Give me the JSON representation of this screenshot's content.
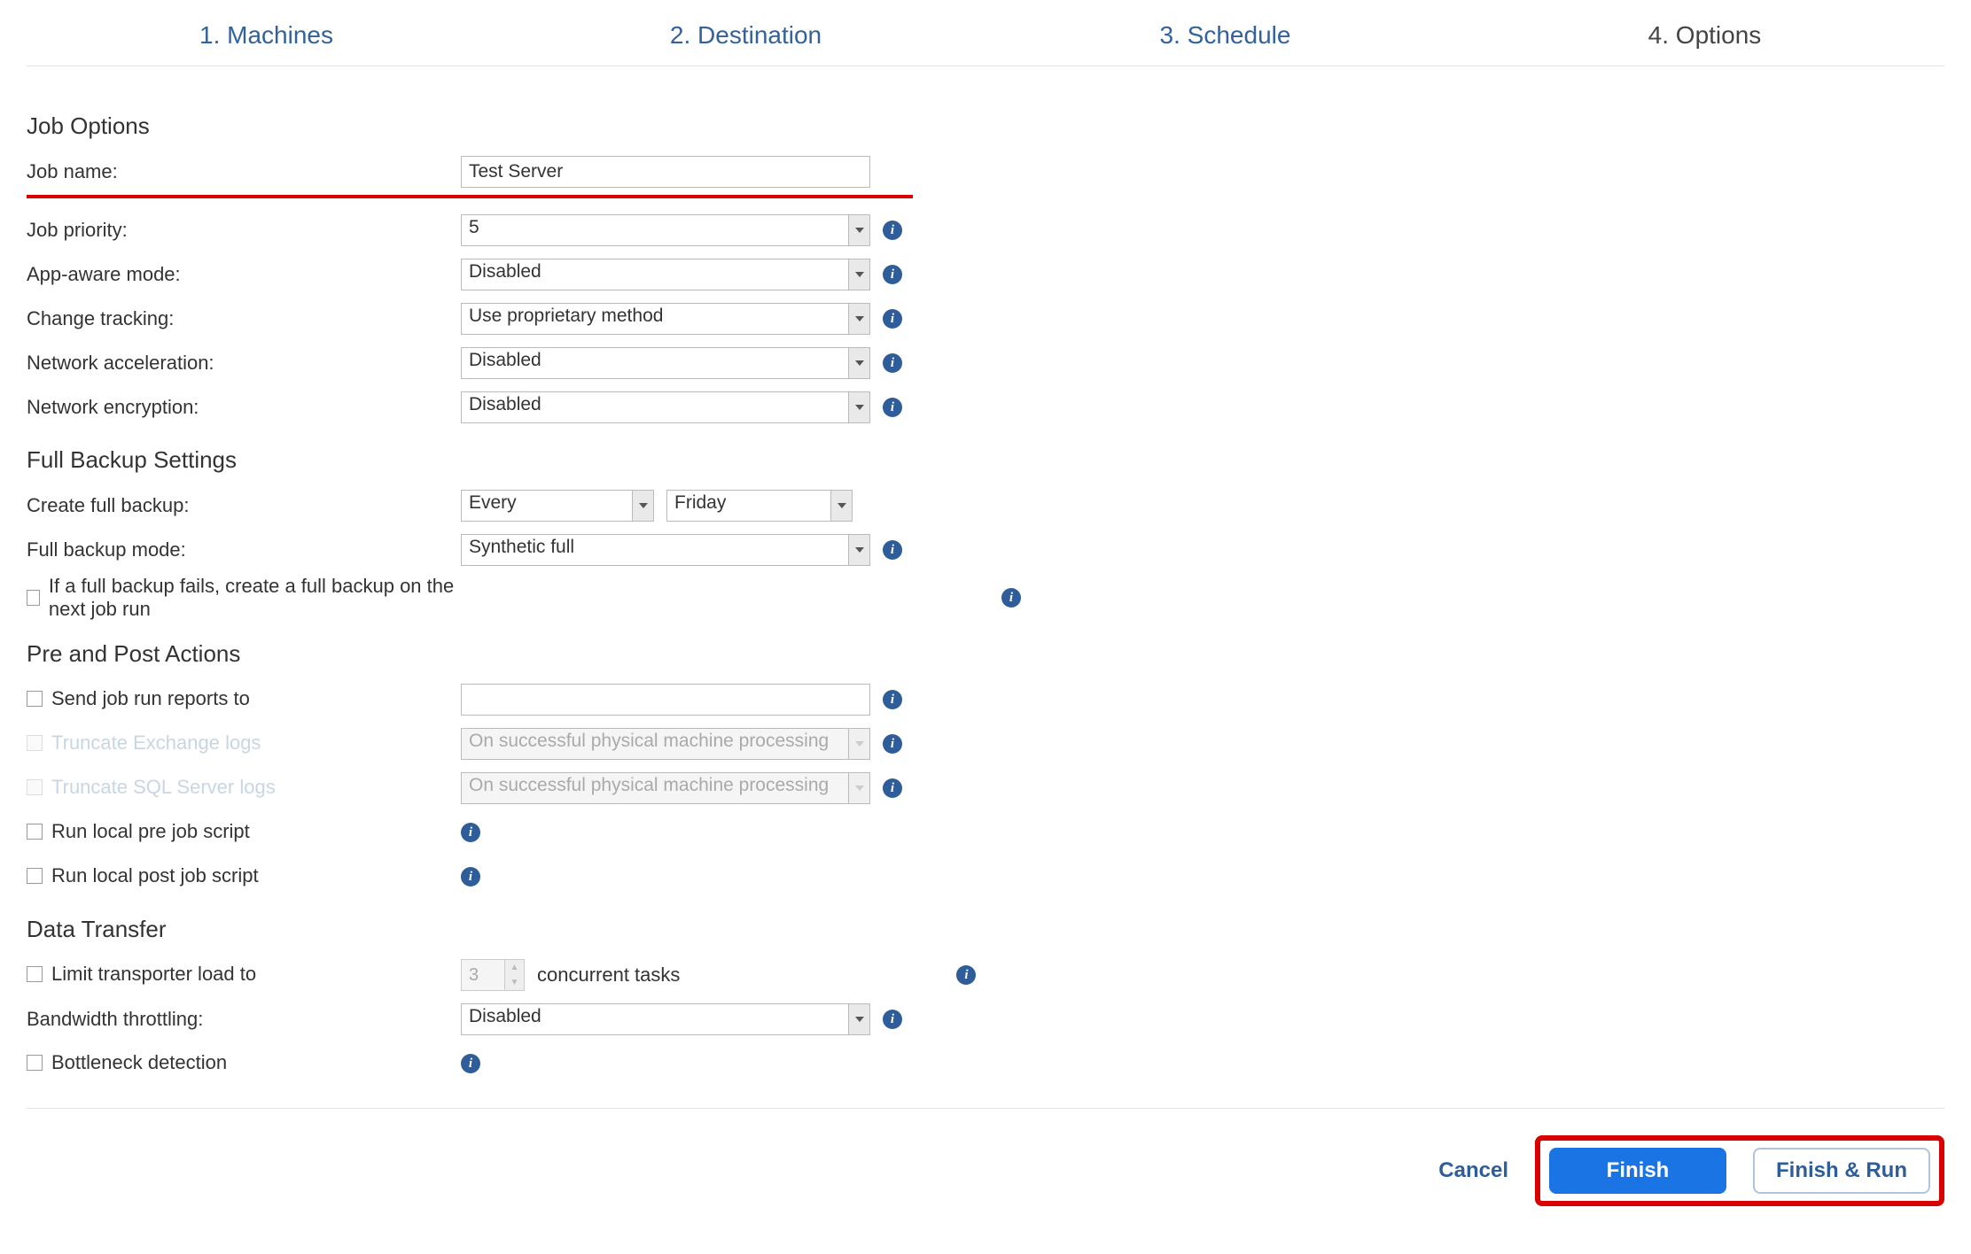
{
  "tabs": {
    "t1": "1. Machines",
    "t2": "2. Destination",
    "t3": "3. Schedule",
    "t4": "4. Options"
  },
  "job_options": {
    "title": "Job Options",
    "name_label": "Job name:",
    "name_value": "Test Server",
    "priority_label": "Job priority:",
    "priority_value": "5",
    "app_aware_label": "App-aware mode:",
    "app_aware_value": "Disabled",
    "change_tracking_label": "Change tracking:",
    "change_tracking_value": "Use proprietary method",
    "net_accel_label": "Network acceleration:",
    "net_accel_value": "Disabled",
    "net_enc_label": "Network encryption:",
    "net_enc_value": "Disabled"
  },
  "full_backup": {
    "title": "Full Backup Settings",
    "create_label": "Create full backup:",
    "create_freq": "Every",
    "create_day": "Friday",
    "mode_label": "Full backup mode:",
    "mode_value": "Synthetic full",
    "retry_label": "If a full backup fails, create a full backup on the next job run"
  },
  "pre_post": {
    "title": "Pre and Post Actions",
    "send_reports_label": "Send job run reports to",
    "send_reports_value": "",
    "truncate_exchange_label": "Truncate Exchange logs",
    "truncate_exchange_value": "On successful physical machine processing",
    "truncate_sql_label": "Truncate SQL Server logs",
    "truncate_sql_value": "On successful physical machine processing",
    "pre_script_label": "Run local pre job script",
    "post_script_label": "Run local post job script"
  },
  "data_transfer": {
    "title": "Data Transfer",
    "limit_label": "Limit transporter load to",
    "limit_value": "3",
    "limit_suffix": "concurrent tasks",
    "throttle_label": "Bandwidth throttling:",
    "throttle_value": "Disabled",
    "bottleneck_label": "Bottleneck detection"
  },
  "footer": {
    "cancel": "Cancel",
    "finish": "Finish",
    "finish_run": "Finish & Run"
  }
}
